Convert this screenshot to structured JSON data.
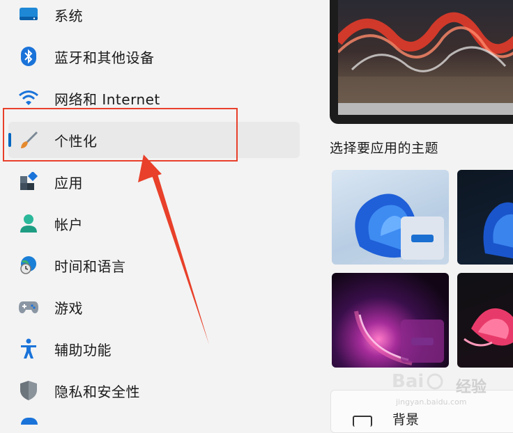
{
  "sidebar": {
    "items": [
      {
        "label": "系统",
        "icon": "monitor-icon"
      },
      {
        "label": "蓝牙和其他设备",
        "icon": "bluetooth-icon"
      },
      {
        "label": "网络和 Internet",
        "icon": "wifi-icon"
      },
      {
        "label": "个性化",
        "icon": "paintbrush-icon",
        "active": true
      },
      {
        "label": "应用",
        "icon": "apps-icon"
      },
      {
        "label": "帐户",
        "icon": "person-icon"
      },
      {
        "label": "时间和语言",
        "icon": "globe-clock-icon"
      },
      {
        "label": "游戏",
        "icon": "gamepad-icon"
      },
      {
        "label": "辅助功能",
        "icon": "accessibility-icon"
      },
      {
        "label": "隐私和安全性",
        "icon": "shield-icon"
      }
    ]
  },
  "main": {
    "theme_section_title": "选择要应用的主题",
    "background_card_label": "背景"
  },
  "watermark": {
    "brand": "经验",
    "url": "jingyan.baidu.com"
  },
  "colors": {
    "accent": "#0067c0",
    "annotation": "#e8402a"
  }
}
